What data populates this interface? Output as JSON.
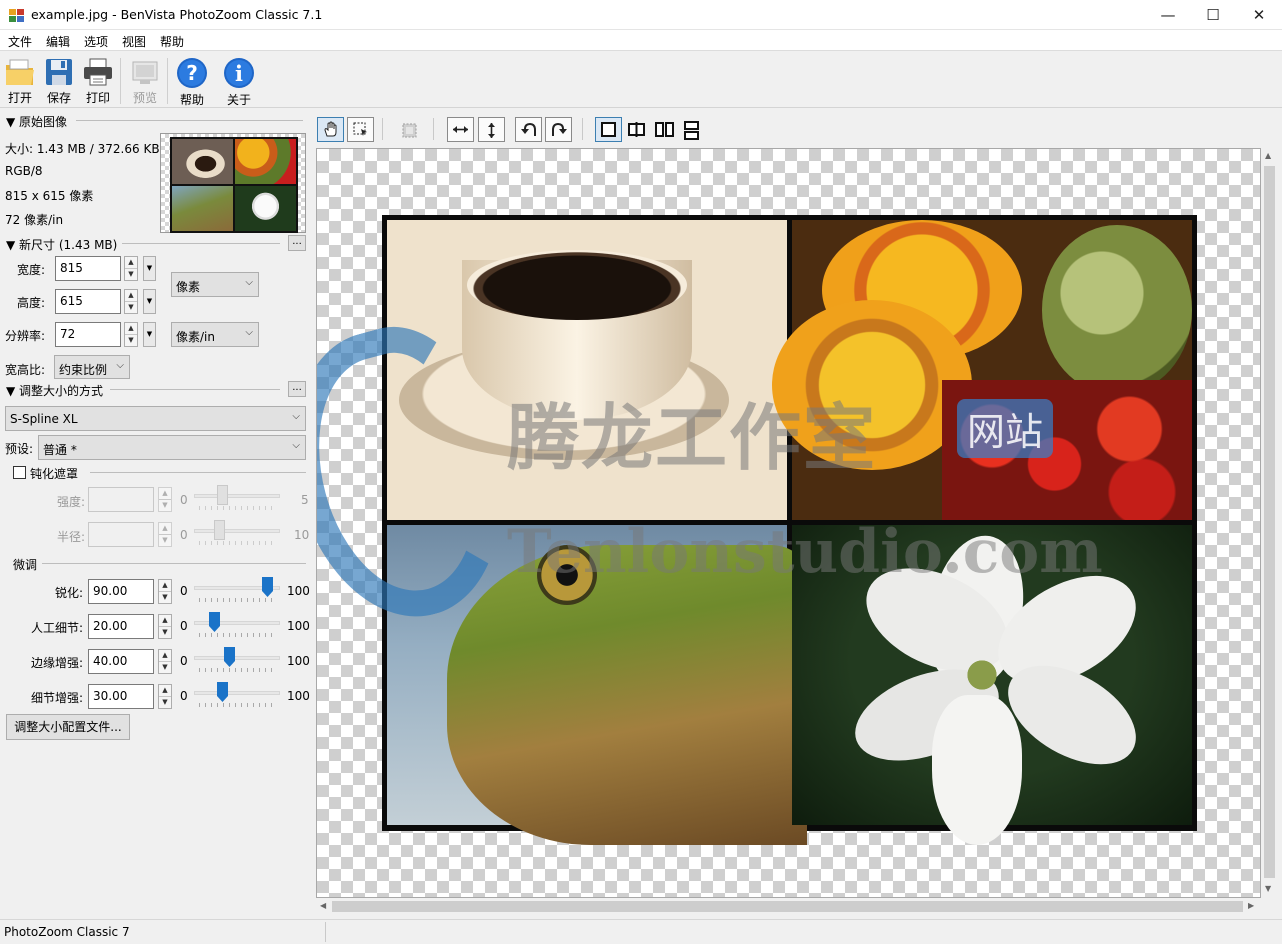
{
  "window": {
    "title": "example.jpg - BenVista PhotoZoom Classic 7.1",
    "minimize_glyph": "—",
    "maximize_glyph": "☐",
    "close_glyph": "✕"
  },
  "menu": [
    "文件",
    "编辑",
    "选项",
    "视图",
    "帮助"
  ],
  "toolbar": {
    "open": "打开",
    "save": "保存",
    "print": "打印",
    "preview": "预览",
    "help": "帮助",
    "about": "关于"
  },
  "original": {
    "header": "▼ 原始图像",
    "size": "大小: 1.43 MB / 372.66 KB",
    "mode": "RGB/8",
    "dimensions": "815 x 615 像素",
    "resolution": "72 像素/in"
  },
  "new_size": {
    "header": "▼ 新尺寸 (1.43 MB)",
    "more": "...",
    "width_label": "宽度:",
    "width_value": "815",
    "height_label": "高度:",
    "height_value": "615",
    "res_label": "分辨率:",
    "res_value": "72",
    "unit_size": "像素",
    "unit_res": "像素/in",
    "aspect_label": "宽高比:",
    "aspect_value": "约束比例"
  },
  "method": {
    "header": "▼ 调整大小的方式",
    "more": "...",
    "algorithm": "S-Spline XL",
    "preset_label": "预设:",
    "preset_value": "普通 *"
  },
  "unsharp": {
    "label": "钝化遮罩",
    "strength_label": "强度:",
    "strength_min": "0",
    "strength_max": "5",
    "strength_level": 0.3,
    "radius_label": "半径:",
    "radius_min": "0",
    "radius_max": "10",
    "radius_level": 0.26
  },
  "fine_tune": {
    "header": "微调",
    "rows": [
      {
        "label": "锐化:",
        "value": "90.00",
        "min": "0",
        "max": "100",
        "level": 0.9
      },
      {
        "label": "人工细节:",
        "value": "20.00",
        "min": "0",
        "max": "100",
        "level": 0.2
      },
      {
        "label": "边缘增强:",
        "value": "40.00",
        "min": "0",
        "max": "100",
        "level": 0.4
      },
      {
        "label": "细节增强:",
        "value": "30.00",
        "min": "0",
        "max": "100",
        "level": 0.3
      }
    ],
    "profiles_button": "调整大小配置文件..."
  },
  "watermark": {
    "line1": "腾龙工作室",
    "badge": "网站",
    "line2": "Tenlonstudio.com"
  },
  "status": {
    "text": "PhotoZoom Classic 7"
  },
  "colors": {
    "accent": "#1a73c8",
    "watermark_blue": "#2f79b8"
  }
}
